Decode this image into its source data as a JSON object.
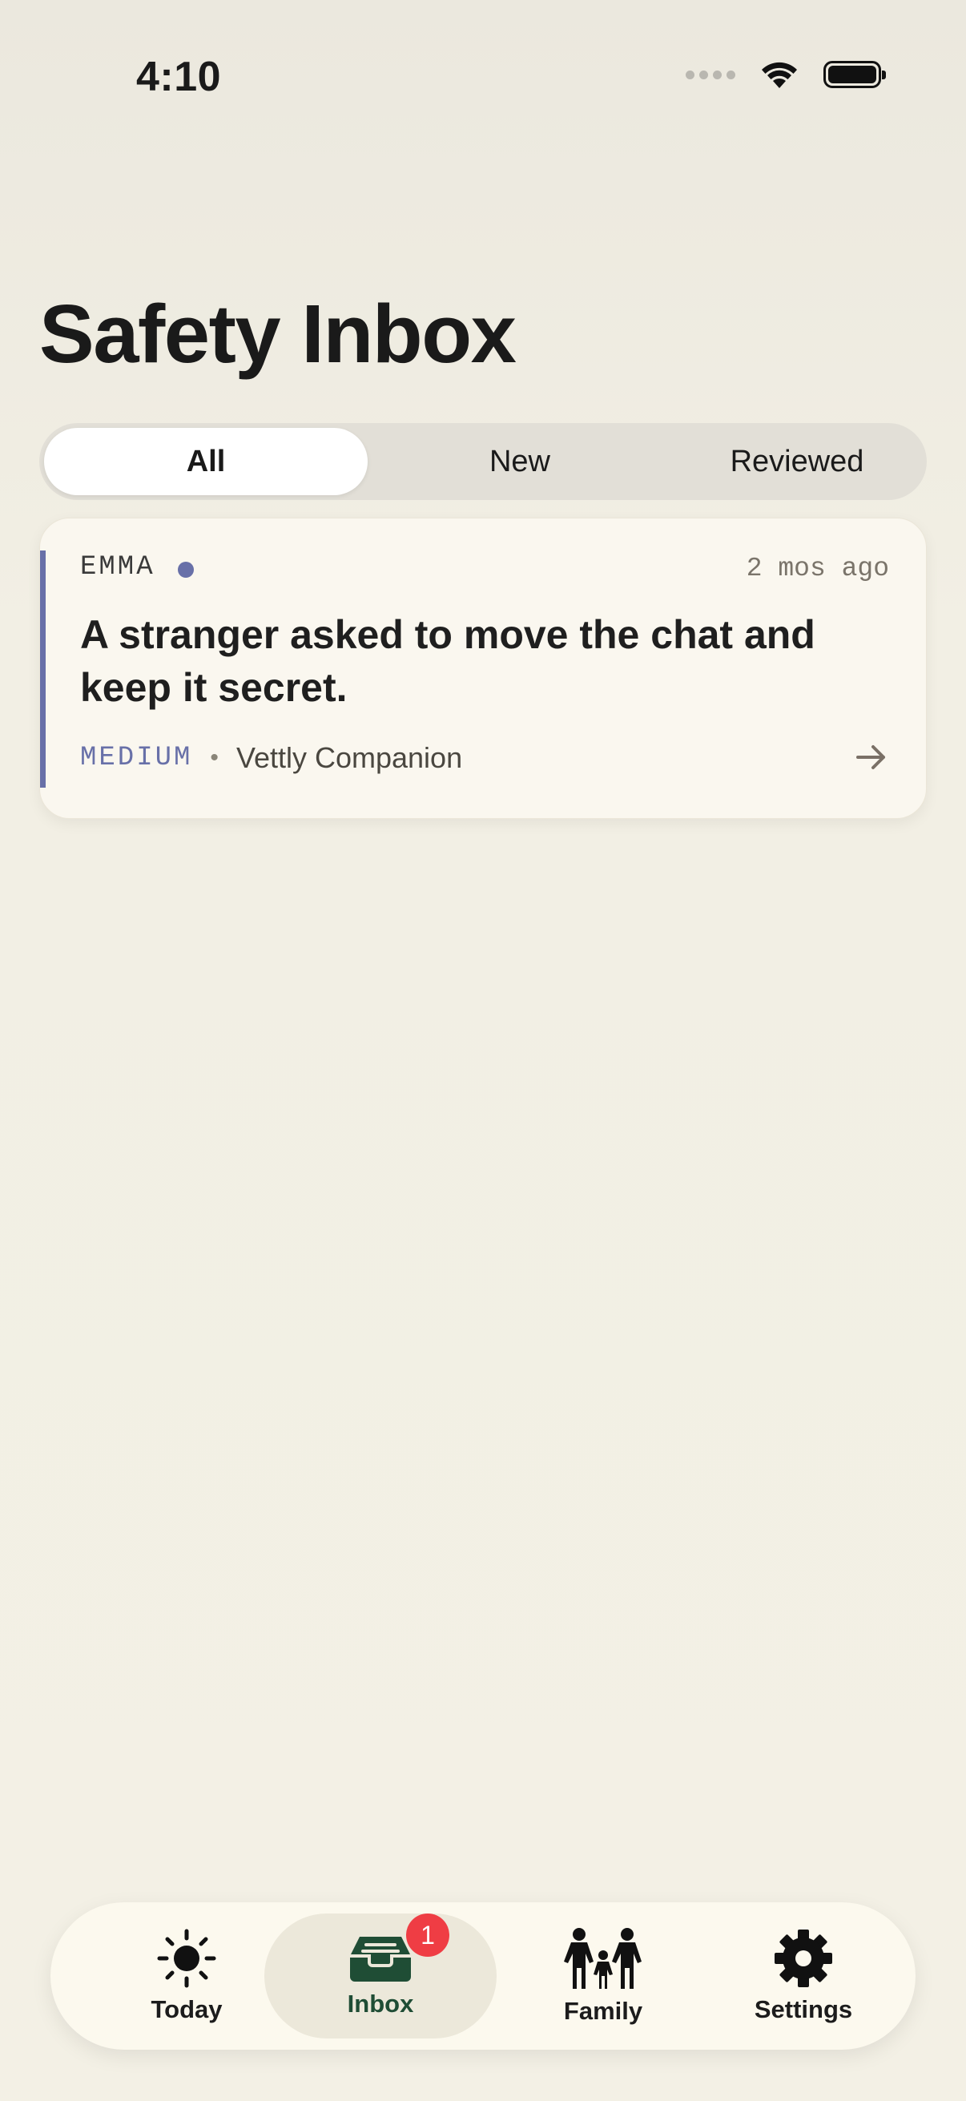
{
  "status_bar": {
    "time": "4:10"
  },
  "header": {
    "title": "Safety Inbox"
  },
  "filters": {
    "selected": "All",
    "all": "All",
    "new": "New",
    "reviewed": "Reviewed"
  },
  "alerts": [
    {
      "child": "EMMA",
      "unread": true,
      "time_ago": "2 mos ago",
      "headline": "A stranger asked to move the chat and keep it secret.",
      "severity": "MEDIUM",
      "source": "Vettly Companion",
      "accent_color": "#6870a8"
    }
  ],
  "tab_bar": {
    "active": "Inbox",
    "today": "Today",
    "inbox": "Inbox",
    "inbox_badge": "1",
    "family": "Family",
    "settings": "Settings"
  },
  "colors": {
    "accent_green": "#1f4d35",
    "badge_red": "#ef3d44",
    "severity_medium": "#6870a8"
  },
  "icons": {
    "today": "sun-icon",
    "inbox": "inbox-tray-icon",
    "family": "family-icon",
    "settings": "gear-icon",
    "card_action": "arrow-right-icon"
  }
}
